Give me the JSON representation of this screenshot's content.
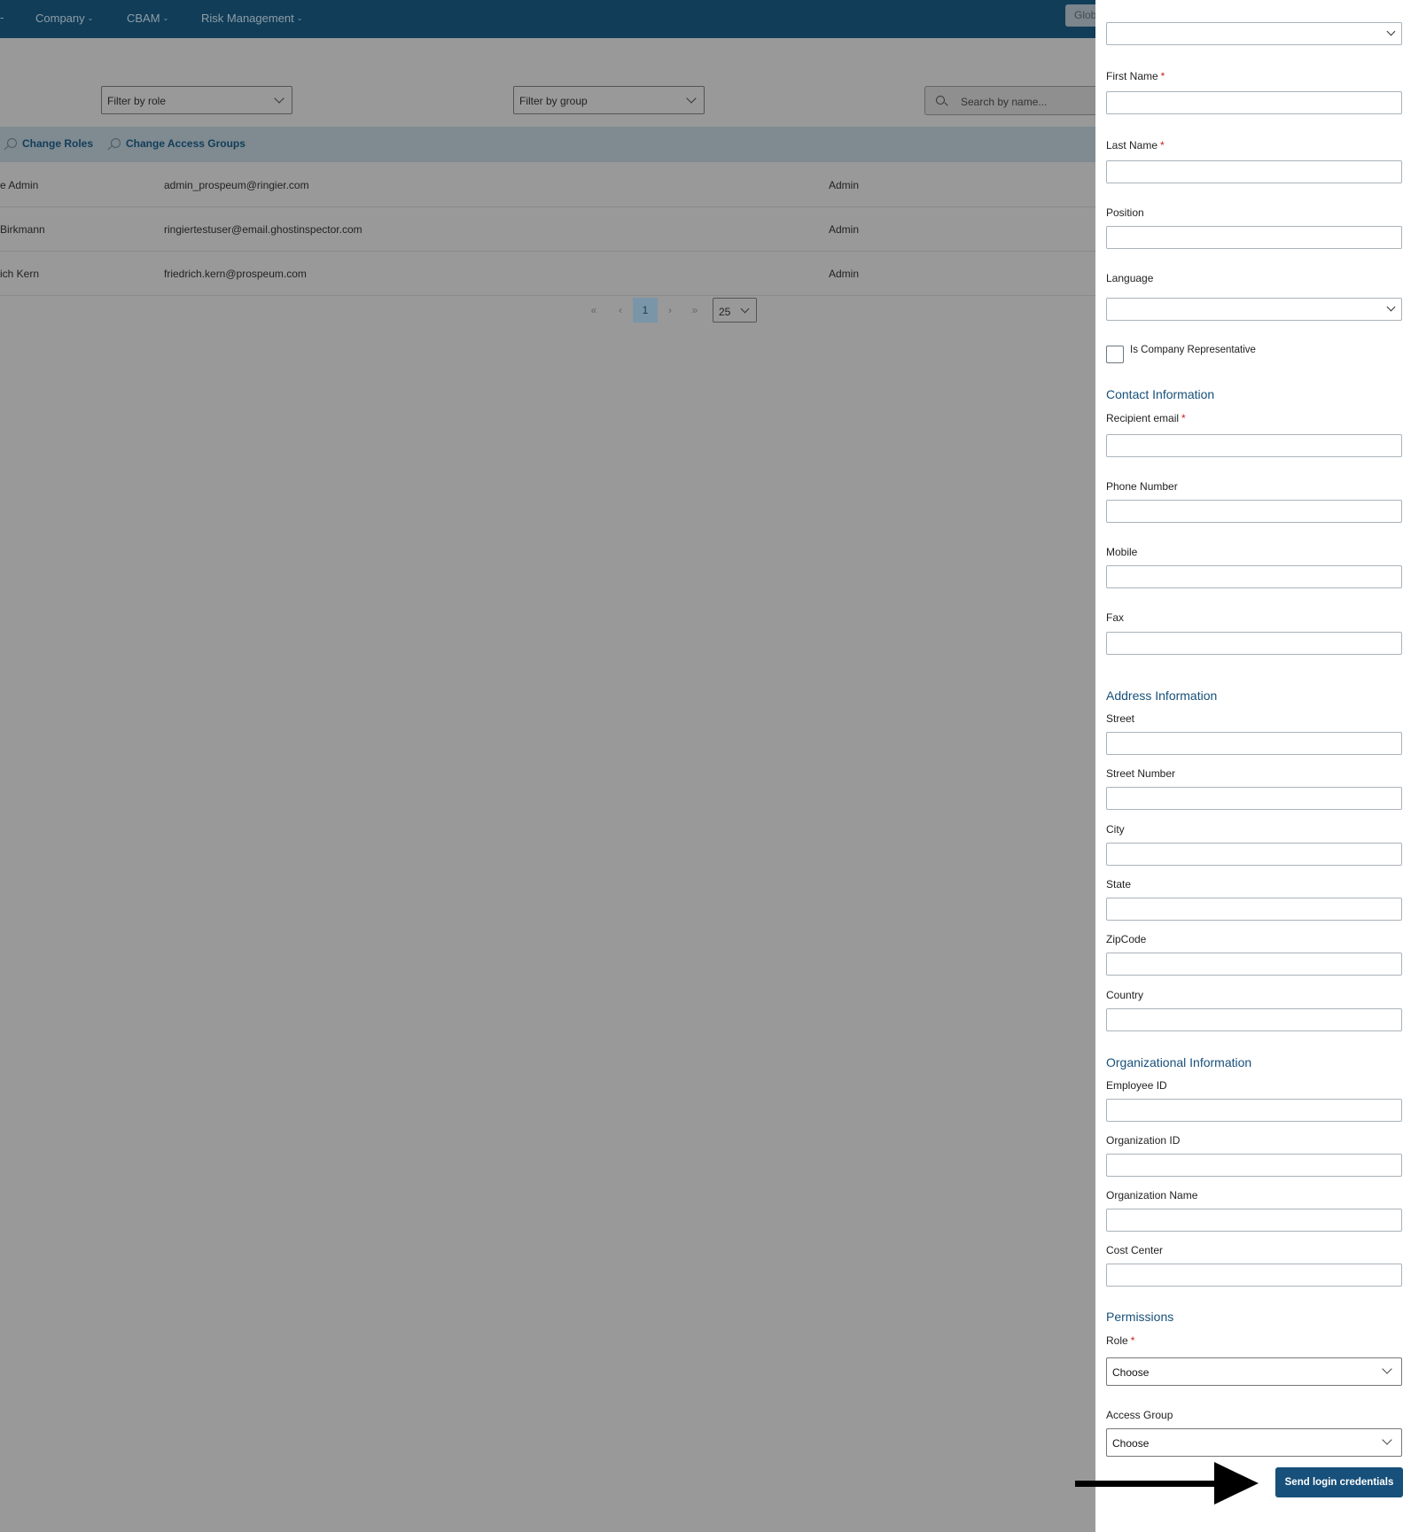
{
  "nav": {
    "items": [
      {
        "label": "Company"
      },
      {
        "label": "CBAM"
      },
      {
        "label": "Risk Management"
      }
    ],
    "global_button": "Glob"
  },
  "filters": {
    "role": "Filter by role",
    "group": "Filter by group",
    "search_placeholder": "Search by name..."
  },
  "toolbar": {
    "change_roles": "Change Roles",
    "change_access_groups": "Change Access Groups"
  },
  "users": [
    {
      "name": "e Admin",
      "email": "admin_prospeum@ringier.com",
      "role": "Admin"
    },
    {
      "name": "Birkmann",
      "email": "ringiertestuser@email.ghostinspector.com",
      "role": "Admin"
    },
    {
      "name": "ich Kern",
      "email": "friedrich.kern@prospeum.com",
      "role": "Admin"
    }
  ],
  "pagination": {
    "first": "«",
    "prev": "‹",
    "current": "1",
    "next": "›",
    "last": "»",
    "page_size": "25"
  },
  "form": {
    "first_name": "First Name",
    "last_name": "Last Name",
    "position": "Position",
    "language": "Language",
    "is_company_rep": "Is Company Representative",
    "contact_section": "Contact Information",
    "recipient_email": "Recipient email",
    "phone": "Phone Number",
    "mobile": "Mobile",
    "fax": "Fax",
    "address_section": "Address Information",
    "street": "Street",
    "street_number": "Street Number",
    "city": "City",
    "state": "State",
    "zipcode": "ZipCode",
    "country": "Country",
    "org_section": "Organizational Information",
    "employee_id": "Employee ID",
    "organization_id": "Organization ID",
    "organization_name": "Organization Name",
    "cost_center": "Cost Center",
    "permissions_section": "Permissions",
    "role": "Role",
    "role_value": "Choose",
    "access_group": "Access Group",
    "access_group_value": "Choose",
    "required_mark": "*",
    "submit": "Send login credentials"
  },
  "colors": {
    "nav_bg": "#113d58",
    "accent": "#17507a",
    "required": "#d11a1a",
    "overlay": "#999999"
  }
}
